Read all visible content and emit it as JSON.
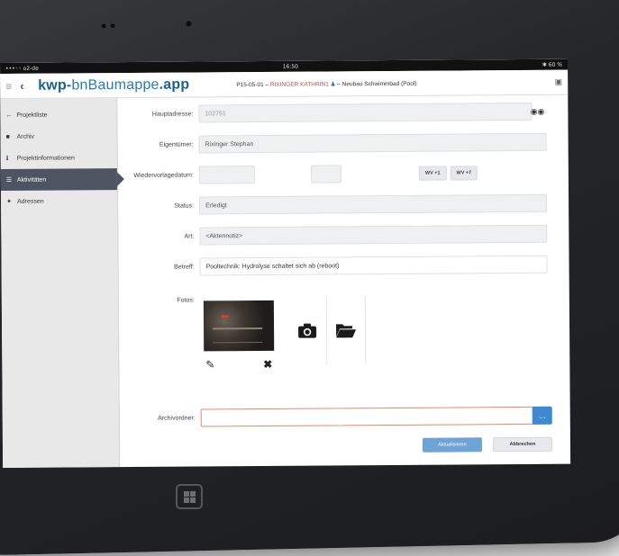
{
  "statusbar": {
    "carrier": "•••◦◦ o2-de",
    "time": "16:50",
    "battery": "✱ 60 %"
  },
  "appbar": {
    "logo_bold": "kwp-",
    "logo_thin": "bnBaumappe",
    "logo_suffix": ".app",
    "project_code": "P15-05-01 –",
    "project_owner": "RIXINGER KATHRIN1",
    "project_name": "– Neubau Schwimmbad (Pool)"
  },
  "sidebar": {
    "items": [
      {
        "label": "Projektliste",
        "icon": "←",
        "active": false
      },
      {
        "label": "Archiv",
        "icon": "■",
        "active": false
      },
      {
        "label": "Projektinformationen",
        "icon": "ℹ",
        "active": false
      },
      {
        "label": "Aktivitäten",
        "icon": "☰",
        "active": true
      },
      {
        "label": "Adressen",
        "icon": "✦",
        "active": false
      }
    ]
  },
  "form": {
    "hauptadresse_label": "Hauptadresse:",
    "hauptadresse_value": "102751",
    "eigentuemer_label": "Eigentümer:",
    "eigentuemer_value": "Rixinger Stephan",
    "wiedervorlage_label": "Wiedervorlagedatum:",
    "wv1_label": "WV +1",
    "wv7_label": "WV +7",
    "status_label": "Status:",
    "status_value": "Erledigt",
    "art_label": "Art:",
    "art_value": "<Aktennotiz>",
    "betreff_label": "Betreff:",
    "betreff_value": "Pooltechnik: Hydrolyse schaltet sich ab (reboot)",
    "fotos_label": "Fotos:",
    "archivordner_label": "Archivordner:",
    "archivordner_value": "",
    "dots_label": "...",
    "save_label": "Aktualisieren",
    "cancel_label": "Abbrechen"
  }
}
